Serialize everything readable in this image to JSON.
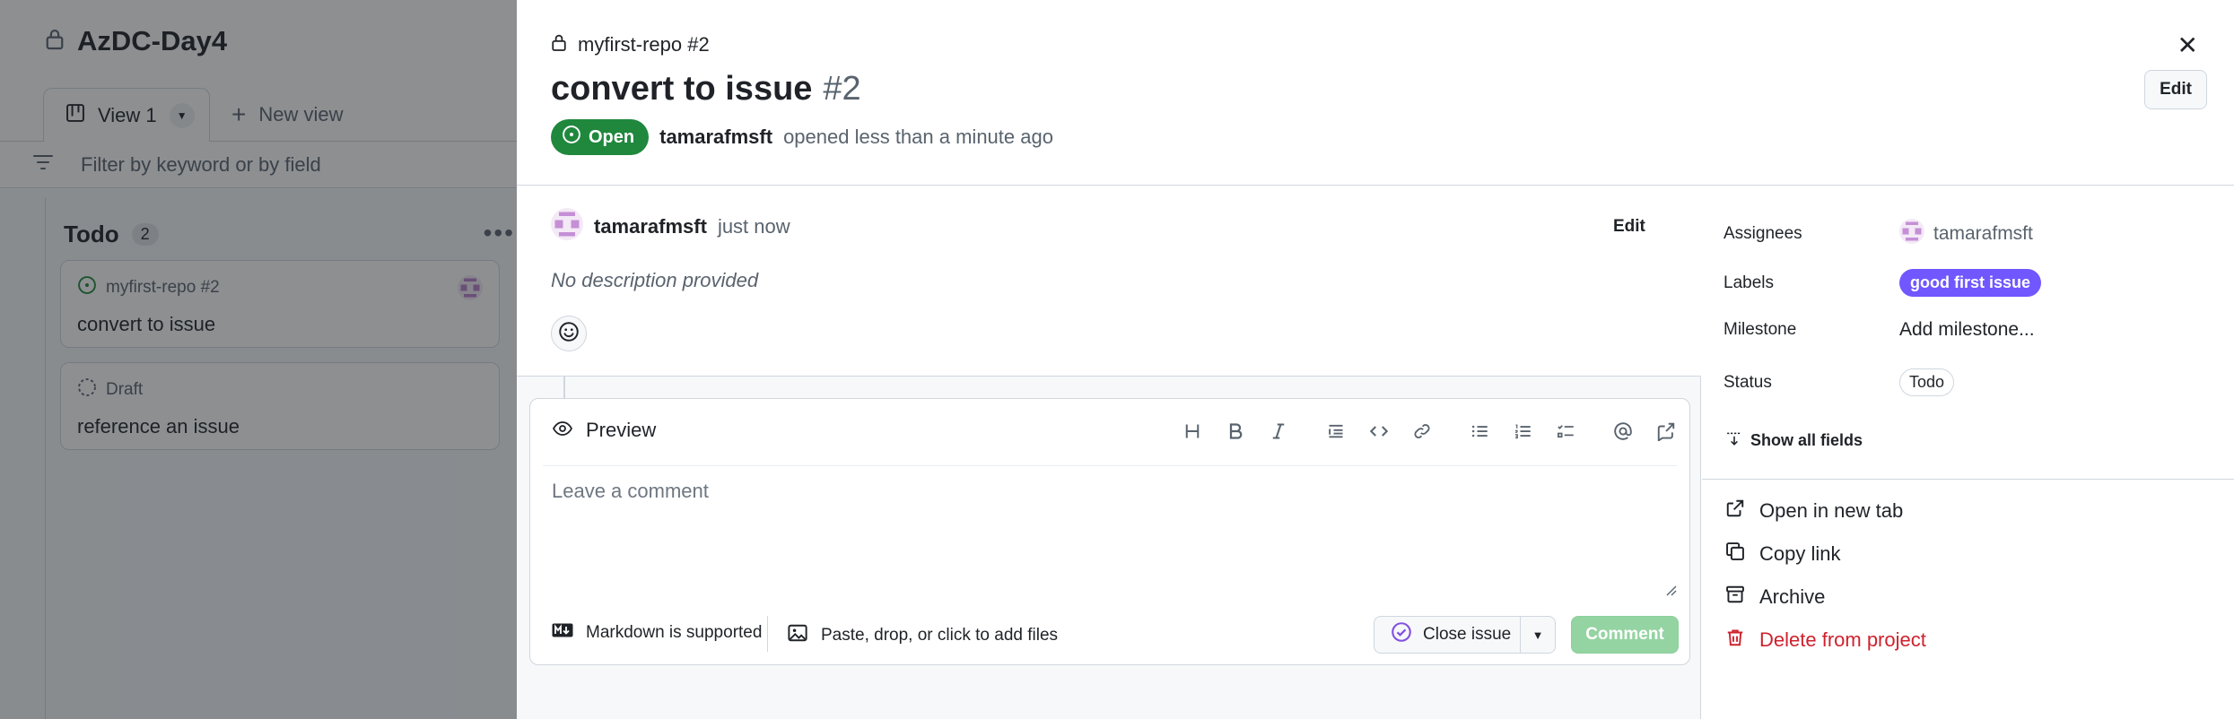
{
  "board": {
    "title": "AzDC-Day4",
    "view_tab_label": "View 1",
    "new_view_label": "New view",
    "filter_placeholder": "Filter by keyword or by field",
    "column": {
      "name": "Todo",
      "count": "2",
      "cards": [
        {
          "meta": "myfirst-repo #2",
          "title": "convert to issue",
          "state": "open"
        },
        {
          "meta": "Draft",
          "title": "reference an issue",
          "state": "draft"
        }
      ]
    }
  },
  "panel": {
    "repo": "myfirst-repo #2",
    "title": "convert to issue",
    "number": "#2",
    "state_label": "Open",
    "author": "tamarafmsft",
    "opened_text": "opened less than a minute ago",
    "edit_label": "Edit",
    "comment": {
      "author": "tamarafmsft",
      "time": "just now",
      "edit_label": "Edit",
      "body": "No description provided"
    },
    "editor": {
      "preview_label": "Preview",
      "placeholder": "Leave a comment",
      "markdown_label": "Markdown is supported",
      "paste_label": "Paste, drop, or click to add files",
      "close_issue_label": "Close issue",
      "comment_label": "Comment"
    },
    "fields": {
      "assignees_label": "Assignees",
      "assignee": "tamarafmsft",
      "labels_label": "Labels",
      "label": "good first issue",
      "milestone_label": "Milestone",
      "milestone_value": "Add milestone...",
      "status_label": "Status",
      "status_value": "Todo",
      "show_all_label": "Show all fields"
    },
    "actions": {
      "open_new_tab": "Open in new tab",
      "copy_link": "Copy link",
      "archive": "Archive",
      "delete": "Delete from project"
    }
  },
  "colors": {
    "open_green": "#1f883d",
    "label_purple": "#7057ff",
    "danger_red": "#cf222e",
    "comment_btn_disabled": "#94d3a2"
  }
}
